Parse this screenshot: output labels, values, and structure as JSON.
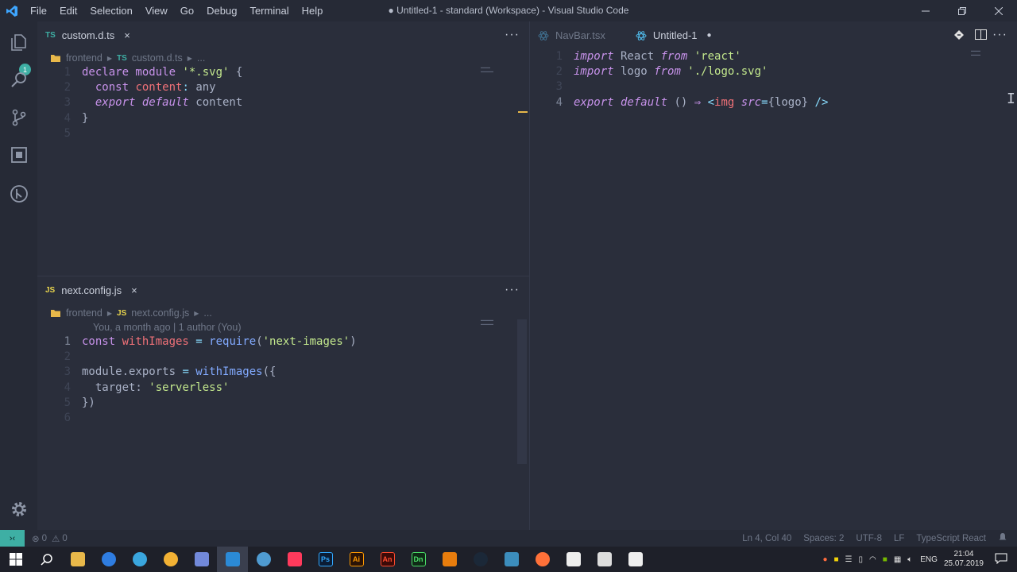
{
  "titlebar": {
    "menu": [
      "File",
      "Edit",
      "Selection",
      "View",
      "Go",
      "Debug",
      "Terminal",
      "Help"
    ],
    "window_title": "● Untitled-1 - standard (Workspace) - Visual Studio Code"
  },
  "activity": {
    "explorer_badge": "1"
  },
  "pane_top_left": {
    "tab": {
      "lang": "TS",
      "label": "custom.d.ts",
      "close": "×"
    },
    "more": "···",
    "breadcrumb": {
      "folder": "frontend",
      "lang": "TS",
      "file": "custom.d.ts",
      "ellipsis": "..."
    },
    "lines": [
      {
        "n": "1",
        "parts": [
          {
            "c": "kw",
            "t": "declare module "
          },
          {
            "c": "str",
            "t": "'*.svg'"
          },
          {
            "c": "pl",
            "t": " {"
          }
        ]
      },
      {
        "n": "2",
        "parts": [
          {
            "c": "kw",
            "t": "  const "
          },
          {
            "c": "var",
            "t": "content"
          },
          {
            "c": "type",
            "t": ":"
          },
          {
            "c": "pl",
            "t": " any"
          }
        ]
      },
      {
        "n": "3",
        "parts": [
          {
            "c": "kw-i",
            "t": "  export default"
          },
          {
            "c": "pl",
            "t": " content"
          }
        ]
      },
      {
        "n": "4",
        "parts": [
          {
            "c": "pl",
            "t": "}"
          }
        ]
      },
      {
        "n": "5",
        "parts": []
      }
    ]
  },
  "pane_bottom_left": {
    "tab": {
      "lang": "JS",
      "label": "next.config.js",
      "close": "×"
    },
    "more": "···",
    "breadcrumb": {
      "folder": "frontend",
      "lang": "JS",
      "file": "next.config.js",
      "ellipsis": "..."
    },
    "blame": "You, a month ago | 1 author (You)",
    "lines": [
      {
        "n": "1",
        "parts": [
          {
            "c": "kw",
            "t": "const "
          },
          {
            "c": "var",
            "t": "withImages"
          },
          {
            "c": "type",
            "t": " = "
          },
          {
            "c": "fn",
            "t": "require"
          },
          {
            "c": "pl",
            "t": "("
          },
          {
            "c": "str",
            "t": "'next-images'"
          },
          {
            "c": "pl",
            "t": ")"
          }
        ]
      },
      {
        "n": "2",
        "parts": []
      },
      {
        "n": "3",
        "parts": [
          {
            "c": "pl",
            "t": "module.exports "
          },
          {
            "c": "type",
            "t": "= "
          },
          {
            "c": "fn",
            "t": "withImages"
          },
          {
            "c": "pl",
            "t": "({"
          }
        ]
      },
      {
        "n": "4",
        "parts": [
          {
            "c": "pl",
            "t": "  target: "
          },
          {
            "c": "str",
            "t": "'serverless'"
          }
        ]
      },
      {
        "n": "5",
        "parts": [
          {
            "c": "pl",
            "t": "})"
          }
        ]
      },
      {
        "n": "6",
        "parts": []
      }
    ]
  },
  "pane_right": {
    "tabs": [
      {
        "label": "NavBar.tsx",
        "active": false
      },
      {
        "label": "Untitled-1",
        "active": true,
        "dirty": "●"
      }
    ],
    "lines": [
      {
        "n": "1",
        "parts": [
          {
            "c": "kw-i",
            "t": "import"
          },
          {
            "c": "pl",
            "t": " React "
          },
          {
            "c": "kw-i",
            "t": "from"
          },
          {
            "c": "str",
            "t": " 'react'"
          }
        ]
      },
      {
        "n": "2",
        "parts": [
          {
            "c": "kw-i",
            "t": "import"
          },
          {
            "c": "pl",
            "t": " logo "
          },
          {
            "c": "kw-i",
            "t": "from"
          },
          {
            "c": "str",
            "t": " './logo.svg'"
          }
        ]
      },
      {
        "n": "3",
        "parts": []
      },
      {
        "n": "4",
        "parts": [
          {
            "c": "kw-i",
            "t": "export default"
          },
          {
            "c": "pl",
            "t": " () "
          },
          {
            "c": "kw",
            "t": "⇒"
          },
          {
            "c": "pl",
            "t": " "
          },
          {
            "c": "type",
            "t": "<"
          },
          {
            "c": "var",
            "t": "img"
          },
          {
            "c": "pl",
            "t": " "
          },
          {
            "c": "kw-i",
            "t": "src"
          },
          {
            "c": "type",
            "t": "="
          },
          {
            "c": "pl",
            "t": "{logo} "
          },
          {
            "c": "type",
            "t": "/>"
          }
        ]
      }
    ]
  },
  "statusbar": {
    "errors": "0",
    "warnings": "0",
    "position": "Ln 4, Col 40",
    "spaces": "Spaces: 2",
    "encoding": "UTF-8",
    "eol": "LF",
    "language": "TypeScript React"
  },
  "taskbar": {
    "apps": [
      {
        "name": "explorer",
        "color": "#e8b84a",
        "label": ""
      },
      {
        "name": "firefox-dev",
        "color": "#2f7de1",
        "label": ""
      },
      {
        "name": "telegram",
        "color": "#3aa6de",
        "label": ""
      },
      {
        "name": "chrome-canary",
        "color": "#f2b134",
        "label": ""
      },
      {
        "name": "discord",
        "color": "#7289da",
        "label": ""
      },
      {
        "name": "vscode",
        "color": "#2b8ad6",
        "label": ""
      },
      {
        "name": "browser",
        "color": "#4f9bd1",
        "label": ""
      },
      {
        "name": "app-red",
        "color": "#ff3a5c",
        "label": ""
      },
      {
        "name": "photoshop",
        "color": "#0b1c34",
        "label": "Ps"
      },
      {
        "name": "illustrator",
        "color": "#2a1306",
        "label": "Ai"
      },
      {
        "name": "animate",
        "color": "#3b0a08",
        "label": "An"
      },
      {
        "name": "dimension",
        "color": "#0f2a16",
        "label": "Dn"
      },
      {
        "name": "blender",
        "color": "#e87d0d",
        "label": ""
      },
      {
        "name": "steam",
        "color": "#1b2838",
        "label": ""
      },
      {
        "name": "bitwarden",
        "color": "#3c8dbc",
        "label": ""
      },
      {
        "name": "firefox",
        "color": "#ff7139",
        "label": ""
      },
      {
        "name": "inkscape",
        "color": "#eeeeee",
        "label": ""
      },
      {
        "name": "photos",
        "color": "#dddddd",
        "label": ""
      },
      {
        "name": "github",
        "color": "#eeeeee",
        "label": ""
      }
    ],
    "lang": "ENG",
    "time": "21:04",
    "date": "25.07.2019"
  }
}
